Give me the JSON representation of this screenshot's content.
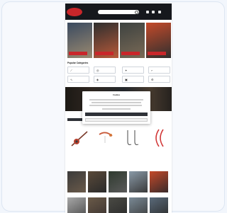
{
  "header": {
    "logo_text": "",
    "search_placeholder": "",
    "brand_color": "#c9262a",
    "background": "#16181d"
  },
  "banners": [
    {
      "label": "",
      "colors": [
        "#3a4a60",
        "#9b8a70"
      ]
    },
    {
      "label": "",
      "colors": [
        "#2e2e2e",
        "#b85a3a"
      ]
    },
    {
      "label": "",
      "colors": [
        "#3d4240",
        "#7a6a56"
      ]
    },
    {
      "label": "",
      "colors": [
        "#c44a2a",
        "#2f2f2f"
      ]
    }
  ],
  "categories": {
    "title": "Popular Categories",
    "items": [
      {
        "icon": "rod-icon",
        "glyph": "⟋",
        "label": ""
      },
      {
        "icon": "reel-icon",
        "glyph": "◎",
        "label": ""
      },
      {
        "icon": "lure-icon",
        "glyph": "✦",
        "label": ""
      },
      {
        "icon": "hook-icon",
        "glyph": "⌐",
        "label": ""
      },
      {
        "icon": "line-icon",
        "glyph": "∿",
        "label": ""
      },
      {
        "icon": "bait-icon",
        "glyph": "◈",
        "label": ""
      },
      {
        "icon": "tackle-icon",
        "glyph": "▣",
        "label": ""
      },
      {
        "icon": "accessory-icon",
        "glyph": "⚙",
        "label": ""
      }
    ]
  },
  "modal": {
    "title": "Cookies",
    "primary_label": "",
    "secondary_label": ""
  },
  "products": {
    "title": "",
    "items": [
      {
        "name": "",
        "price": "",
        "colors": [
          "#c44a3a",
          "#444"
        ]
      },
      {
        "name": "",
        "price": "",
        "colors": [
          "#d46a4a",
          "#ddd"
        ]
      },
      {
        "name": "",
        "price": "",
        "colors": [
          "#888",
          "#eee"
        ]
      },
      {
        "name": "",
        "price": "",
        "colors": [
          "#d44",
          "#eee"
        ]
      }
    ]
  },
  "gallery": {
    "title": "",
    "thumbs": [
      {
        "colors": [
          "#3a3a3a",
          "#6a5a4a"
        ]
      },
      {
        "colors": [
          "#5a4a3a",
          "#2a2a2a"
        ]
      },
      {
        "colors": [
          "#2f3a2f",
          "#5a5a5a"
        ]
      },
      {
        "colors": [
          "#8a9aa8",
          "#3a3a3a"
        ]
      },
      {
        "colors": [
          "#c44a2a",
          "#3a2a2a"
        ]
      },
      {
        "colors": [
          "#a8a8a8",
          "#4a4a4a"
        ]
      },
      {
        "colors": [
          "#6a5a48",
          "#3a3230"
        ]
      },
      {
        "colors": [
          "#4a4a44",
          "#2a2a2a"
        ]
      },
      {
        "colors": [
          "#7a8a96",
          "#3a3a3a"
        ]
      },
      {
        "colors": [
          "#5a6a7a",
          "#2a2a2a"
        ]
      }
    ]
  }
}
